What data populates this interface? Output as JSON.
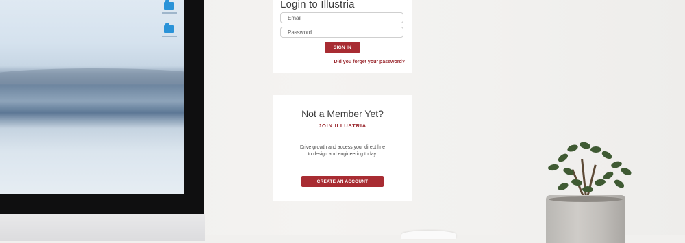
{
  "login": {
    "title": "Login to Illustria",
    "email_placeholder": "Email",
    "password_placeholder": "Password",
    "signin_label": "SIGN IN",
    "forgot_label": "Did you forget your password?"
  },
  "join": {
    "title": "Not a Member Yet?",
    "link_label": "JOIN ILLUSTRIA",
    "description": "Drive growth and access your direct line to design and engineering today.",
    "create_label": "CREATE AN ACCOUNT"
  },
  "colors": {
    "accent": "#a82c32",
    "link": "#9b2a30",
    "card_background": "#ffffff",
    "heading": "#3b3b3b"
  }
}
